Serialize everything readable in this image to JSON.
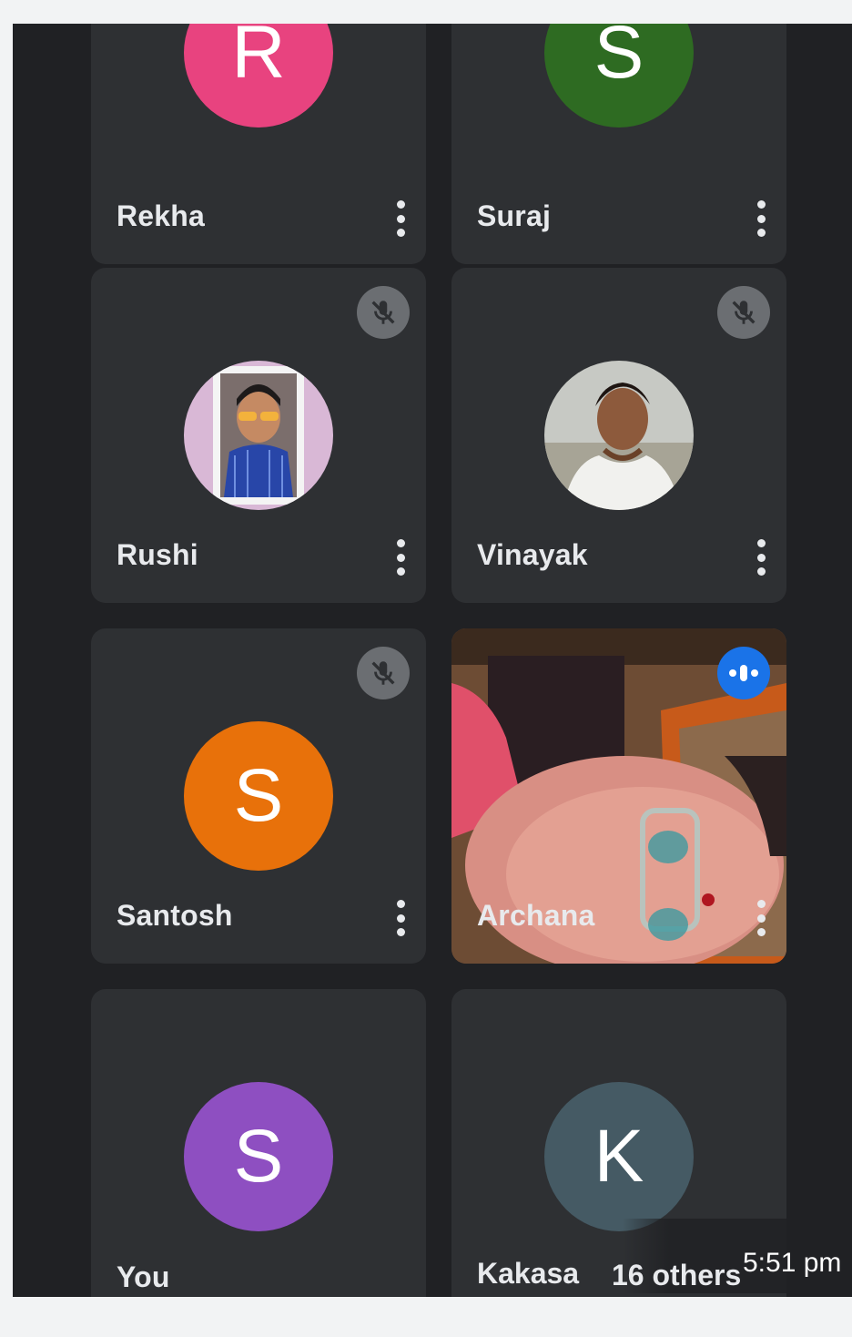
{
  "participants": [
    {
      "name": "Rekha",
      "initial": "R",
      "avatar_color": "#e8437f",
      "muted": false
    },
    {
      "name": "Suraj",
      "initial": "S",
      "avatar_color": "#2e6b22",
      "muted": false
    },
    {
      "name": "Rushi",
      "photo": true,
      "muted": true
    },
    {
      "name": "Vinayak",
      "photo": true,
      "muted": true
    },
    {
      "name": "Santosh",
      "initial": "S",
      "avatar_color": "#e8710a",
      "muted": true
    },
    {
      "name": "Archana",
      "video": true,
      "speaking": true
    },
    {
      "name": "You",
      "initial": "S",
      "avatar_color": "#8e4fc1"
    },
    {
      "name": "Kakasa",
      "initial": "K",
      "avatar_color": "#455a64"
    }
  ],
  "others_label": "16 others",
  "status_time": "5:51 pm",
  "icons": {
    "mic_off": "mic-off-icon",
    "more": "more-vert-icon",
    "speaking": "audio-level-icon"
  },
  "colors": {
    "background": "#202124",
    "tile": "#2e3033",
    "muted_badge": "#6b6e72",
    "speaking_badge": "#1a73e8"
  }
}
